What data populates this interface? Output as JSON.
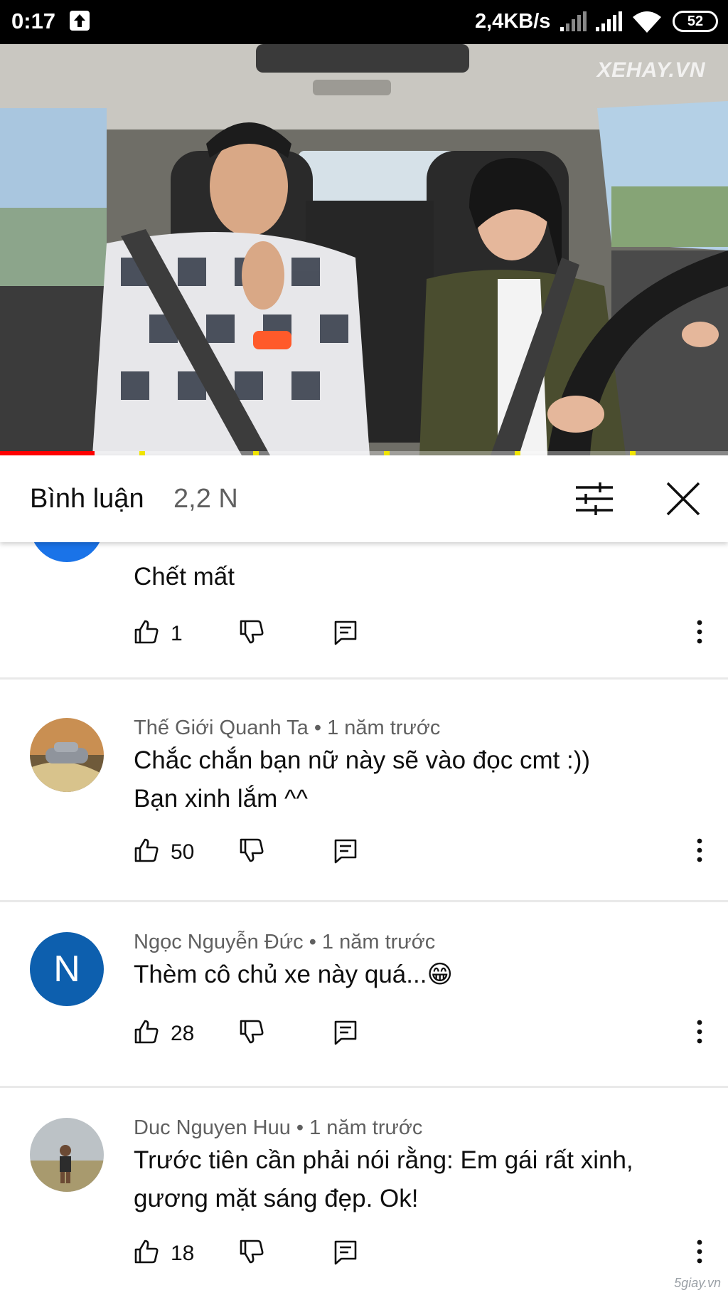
{
  "status_bar": {
    "time": "0:17",
    "network_speed": "2,4KB/s",
    "battery": "52",
    "icons": [
      "upload-arrow-icon",
      "signal-icon",
      "signal-icon",
      "wifi-icon",
      "battery-icon"
    ]
  },
  "video": {
    "watermark": "XEHAY.VN",
    "progress": 0.13
  },
  "comments_panel": {
    "title": "Bình luận",
    "count": "2,2 N",
    "icons": [
      "sort-filter-icon",
      "close-icon"
    ]
  },
  "comments": [
    {
      "author": "",
      "time": "",
      "text": "Chết mất",
      "likes": "1",
      "avatar_color": "#1a73e8"
    },
    {
      "author": "Thế Giới Quanh Ta",
      "time": "1 năm trước",
      "text": "Chắc chắn bạn nữ này sẽ vào đọc cmt :))\nBạn xinh lắm ^^",
      "likes": "50"
    },
    {
      "author": "Ngọc Nguyễn Đức",
      "time": "1 năm trước",
      "text": "Thèm cô chủ xe này quá...😁",
      "likes": "28",
      "avatar_letter": "N",
      "avatar_color": "#0d5fae"
    },
    {
      "author": "Duc Nguyen Huu",
      "time": "1 năm trước",
      "text": "Trước tiên cần phải nói rằng: Em gái rất xinh, gương mặt sáng đẹp. Ok!",
      "likes": "18"
    }
  ],
  "meta_separator": " • ",
  "site_watermark": "5giay.vn"
}
